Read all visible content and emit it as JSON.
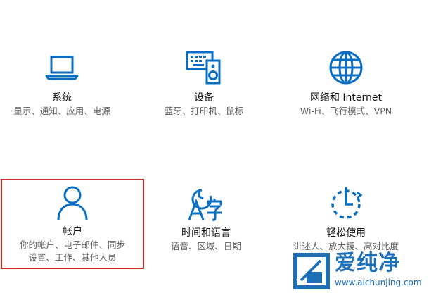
{
  "colors": {
    "accent": "#0a6fc2",
    "selection_border": "#c62828",
    "title_text": "#111111",
    "desc_text": "#5f5f5f"
  },
  "tiles": [
    {
      "id": "system",
      "icon": "laptop-icon",
      "title": "系统",
      "desc": [
        "显示、通知、应用、电源"
      ]
    },
    {
      "id": "devices",
      "icon": "keyboard-speaker-icon",
      "title": "设备",
      "desc": [
        "蓝牙、打印机、鼠标"
      ]
    },
    {
      "id": "network",
      "icon": "globe-icon",
      "title": "网络和 Internet",
      "desc": [
        "Wi-Fi、飞行模式、VPN"
      ]
    },
    {
      "id": "accounts",
      "icon": "person-icon",
      "title": "帐户",
      "desc": [
        "你的帐户、电子邮件、同步",
        "设置、工作、其他人员"
      ]
    },
    {
      "id": "time",
      "icon": "clock-language-icon",
      "title": "时间和语言",
      "desc": [
        "语音、区域、日期"
      ]
    },
    {
      "id": "ease",
      "icon": "ease-of-access-icon",
      "title": "轻松使用",
      "desc": [
        "讲述人、放大镜、高对比度"
      ]
    }
  ],
  "watermark": {
    "brand": "爱纯净",
    "url": "www.aichunjing.com"
  }
}
